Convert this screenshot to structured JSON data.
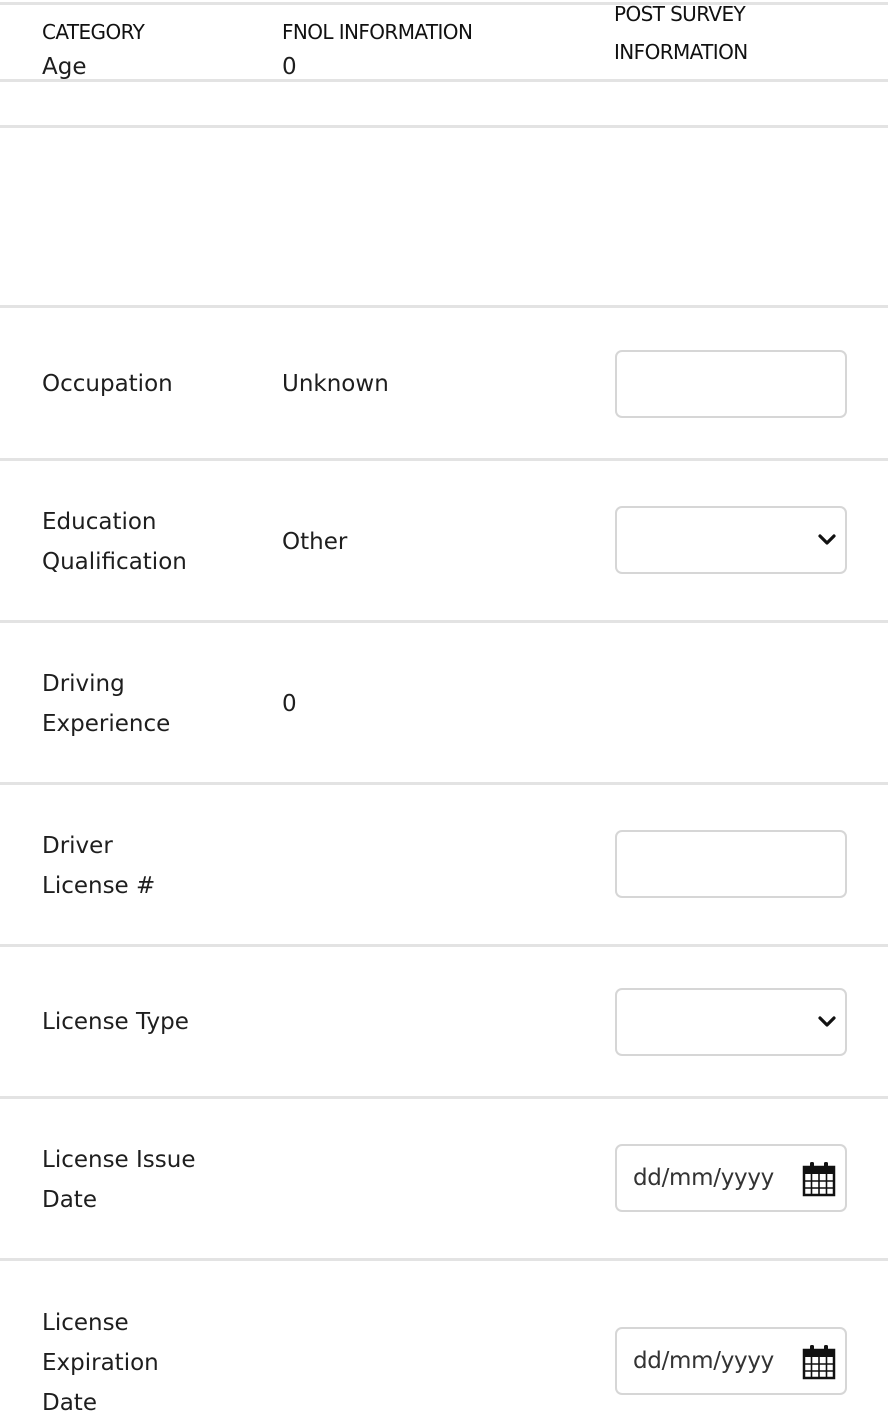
{
  "headers": {
    "category": "CATEGORY",
    "fnol": "FNOL INFORMATION",
    "post_survey_line1": "POST SURVEY",
    "post_survey_line2": "INFORMATION"
  },
  "rows": {
    "age": {
      "label": "Age",
      "fnol": "0"
    },
    "occupation": {
      "label": "Occupation",
      "fnol": "Unknown",
      "input_value": ""
    },
    "education": {
      "label_line1": "Education",
      "label_line2": "Qualification",
      "fnol": "Other",
      "selected": ""
    },
    "driving_experience": {
      "label_line1": "Driving",
      "label_line2": "Experience",
      "fnol": "0"
    },
    "driver_license": {
      "label_line1": "Driver",
      "label_line2": "License #",
      "input_value": ""
    },
    "license_type": {
      "label": "License Type",
      "selected": ""
    },
    "license_issue": {
      "label_line1": "License Issue",
      "label_line2": "Date",
      "date_placeholder": "dd/mm/yyyy"
    },
    "license_expiration": {
      "label_line1": "License",
      "label_line2": "Expiration",
      "label_line3": "Date",
      "date_placeholder": "dd/mm/yyyy"
    }
  },
  "icons": {
    "select": "chevron-down-icon",
    "date": "calendar-icon"
  },
  "colors": {
    "divider": "#e3e3e3",
    "field_border": "#d6d6d6",
    "text": "#1e1e1e"
  }
}
